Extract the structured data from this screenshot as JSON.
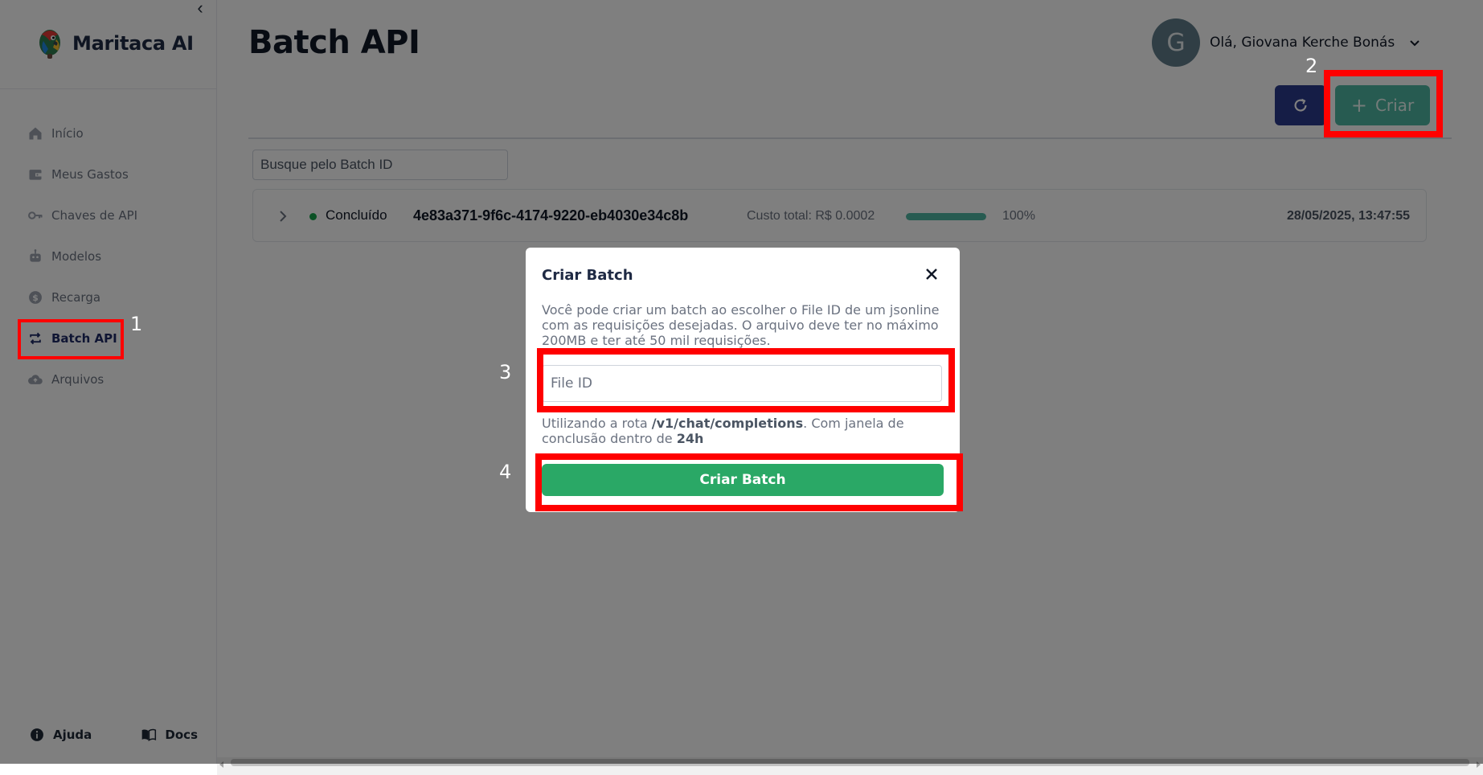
{
  "sidebar": {
    "brand": "Maritaca AI",
    "items": [
      {
        "label": "Início",
        "icon": "home-icon"
      },
      {
        "label": "Meus Gastos",
        "icon": "wallet-icon"
      },
      {
        "label": "Chaves de API",
        "icon": "key-icon"
      },
      {
        "label": "Modelos",
        "icon": "robot-icon"
      },
      {
        "label": "Recarga",
        "icon": "dollar-circle-icon"
      },
      {
        "label": "Batch API",
        "icon": "repeat-icon",
        "active": true
      },
      {
        "label": "Arquivos",
        "icon": "cloud-upload-icon"
      }
    ],
    "footer": {
      "help_label": "Ajuda",
      "docs_label": "Docs"
    }
  },
  "header": {
    "title": "Batch API",
    "user_initial": "G",
    "user_greeting": "Olá, Giovana Kerche Bonás",
    "create_label": "Criar"
  },
  "search": {
    "placeholder": "Busque pelo Batch ID"
  },
  "batches": [
    {
      "status": "Concluído",
      "status_color": "#16a34a",
      "id": "4e83a371-9f6c-4174-9220-eb4030e34c8b",
      "cost": "Custo total: R$ 0.0002",
      "progress": 100,
      "progress_label": "100%",
      "date": "28/05/2025, 13:47:55"
    }
  ],
  "modal": {
    "title": "Criar Batch",
    "description": "Você pode criar um batch ao escolher o File ID de um jsonline com as requisições desejadas. O arquivo deve ter no máximo 200MB e ter até 50 mil requisições.",
    "input_placeholder": "File ID",
    "note_prefix": "Utilizando a rota ",
    "note_route": "/v1/chat/completions",
    "note_middle": ". Com janela de conclusão dentro de ",
    "note_window": "24h",
    "submit_label": "Criar Batch"
  },
  "annotations": [
    "1",
    "2",
    "3",
    "4"
  ],
  "colors": {
    "primary": "#2b3a8c",
    "accent": "#4fb6a3",
    "success": "#2aa866",
    "highlight": "#ff0000"
  }
}
